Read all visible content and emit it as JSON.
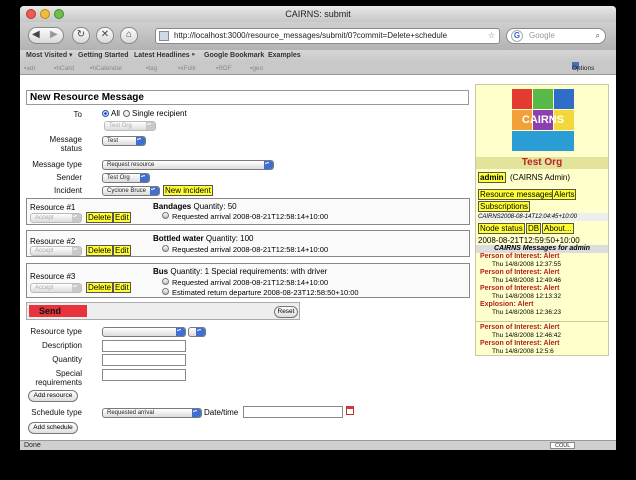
{
  "browser": {
    "title": "CAIRNS: submit",
    "url": "http://localhost:3000/resource_messages/submit/0?commit=Delete+schedule",
    "search_placeholder": "Google",
    "bookmarks": [
      "Most Visited ▾",
      "Getting Started",
      "Latest Headlines ⁍",
      "Google Bookmark",
      "Examples"
    ],
    "ext_items": [
      "adr",
      "hCard",
      "hCalendar",
      "tag",
      "xFolk",
      "RDF",
      "geo"
    ],
    "options_label": "Options",
    "status": "Done",
    "status_badge": "COUL"
  },
  "form": {
    "title": "New Resource Message",
    "to_label": "To",
    "to_all": "All",
    "to_single": "Single recipient",
    "to_recipient": "Test Org",
    "message_status_label": "Message status",
    "message_status": "Test",
    "message_type_label": "Message type",
    "message_type": "Request resource",
    "sender_label": "Sender",
    "sender": "Test Org",
    "incident_label": "Incident",
    "incident": "Cyclone Bruce",
    "new_incident": "New incident",
    "resources": [
      {
        "title": "Resource #1",
        "accept": "Accept",
        "delete": "Delete",
        "edit": "Edit",
        "name": "Bandages",
        "detail": "Quantity: 50",
        "schedules": [
          "Requested arrival 2008-08-21T12:58:14+10:00"
        ]
      },
      {
        "title": "Resource #2",
        "accept": "Accept",
        "delete": "Delete",
        "edit": "Edit",
        "name": "Bottled water",
        "detail": "Quantity: 100",
        "schedules": [
          "Requested arrival 2008-08-21T12:58:14+10:00"
        ]
      },
      {
        "title": "Resource #3",
        "accept": "Accept",
        "delete": "Delete",
        "edit": "Edit",
        "name": "Bus",
        "detail": "Quantity: 1 Special requirements: with driver",
        "schedules": [
          "Requested arrival 2008-08-21T12:58:14+10:00",
          "Estimated return departure 2008-08-23T12:58:50+10:00"
        ]
      }
    ],
    "send": "Send",
    "reset": "Reset",
    "resource_type_label": "Resource type",
    "description_label": "Description",
    "quantity_label": "Quantity",
    "special_label": "Special requirements",
    "add_resource": "Add resource",
    "schedule_type_label": "Schedule type",
    "schedule_type": "Requested arrival",
    "datetime_label": "Date/time",
    "add_schedule": "Add schedule"
  },
  "sidebar": {
    "logo_text": "CAIRNS",
    "org": "Test Org",
    "user": "admin",
    "user_role": "(CAIRNS Admin)",
    "links": [
      "Resource messages",
      "Alerts",
      "Subscriptions"
    ],
    "sync": "CAIRNS2008-08-14T12:04:45+10:00",
    "node_status": "Node status",
    "db": "DB",
    "about": "About...",
    "timestamp": "2008-08-21T12:59:50+10:00",
    "messages_header": "CAIRNS Messages for admin",
    "messages": [
      {
        "title": "Person of Interest: Alert",
        "date": "Thu 14/8/2008 12:37:55"
      },
      {
        "title": "Person of Interest: Alert",
        "date": "Thu 14/8/2008 12:49:46"
      },
      {
        "title": "Person of Interest: Alert",
        "date": "Thu 14/8/2008 12:13:32"
      },
      {
        "title": "Explosion: Alert",
        "date": "Thu 14/8/2008 12:36:23"
      },
      {
        "title": "Person of Interest: Alert",
        "date": "Thu 14/8/2008 12:46:42"
      },
      {
        "title": "Person of Interest: Alert",
        "date": "Thu 14/8/2008 12:5:6"
      }
    ]
  },
  "colors": {
    "highlight": "#ffff33",
    "send": "#e8323c",
    "sidebar_bg": "#ffffcc",
    "alert_red": "#b22222",
    "org_title": "#b8232a"
  }
}
